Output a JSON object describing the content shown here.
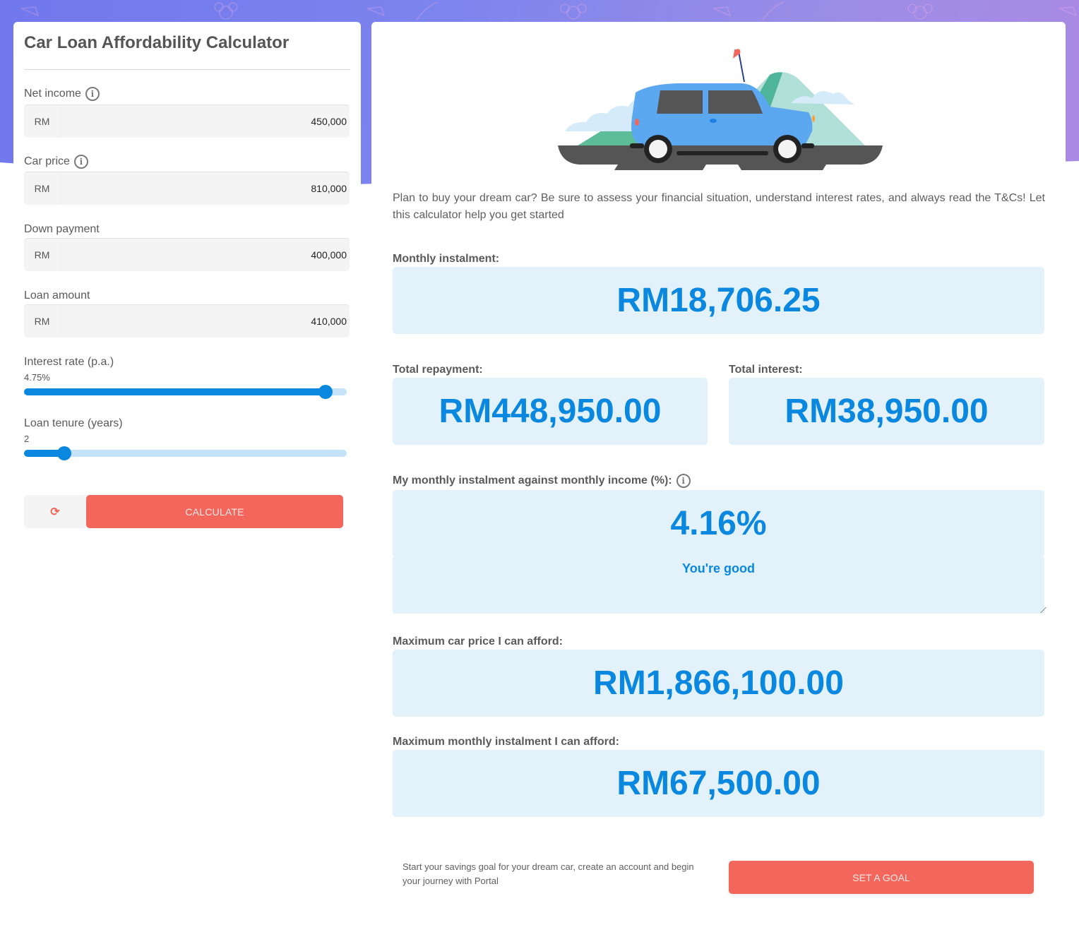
{
  "calculator": {
    "title": "Car Loan Affordability Calculator",
    "fields": [
      {
        "label": "Net income",
        "prefix": "RM",
        "value": "450,000",
        "has_info": true
      },
      {
        "label": "Car price",
        "prefix": "RM",
        "value": "810,000",
        "has_info": true
      },
      {
        "label": "Down payment",
        "prefix": "RM",
        "value": "400,000",
        "has_info": false
      },
      {
        "label": "Loan amount",
        "prefix": "RM",
        "value": "410,000",
        "has_info": false
      }
    ],
    "interest_rate": {
      "label": "Interest rate (p.a.)",
      "value_text": "4.75%",
      "fill_fraction": 0.935
    },
    "loan_tenure": {
      "label": "Loan tenure (years)",
      "value_text": "2",
      "fill_fraction": 0.125
    },
    "reset_icon": "refresh-icon",
    "reset_glyph": "⟳",
    "calculate_label": "CALCULATE",
    "info_glyph": "i"
  },
  "results": {
    "intro": "Plan to buy your dream car? Be sure to assess your financial situation, understand interest rates, and always read the T&Cs! Let this calculator help you get started",
    "monthly_instalment": {
      "label": "Monthly instalment:",
      "value": "RM18,706.25"
    },
    "total_repayment": {
      "label": "Total repayment:",
      "value": "RM448,950.00"
    },
    "total_interest": {
      "label": "Total interest:",
      "value": "RM38,950.00"
    },
    "instalment_vs_income": {
      "label": "My monthly instalment against monthly income (%):",
      "value": "4.16%",
      "status": "You're good"
    },
    "max_car_price": {
      "label": "Maximum car price I can afford:",
      "value": "RM1,866,100.00"
    },
    "max_monthly_instalment": {
      "label": "Maximum monthly instalment I can afford:",
      "value": "RM67,500.00"
    }
  },
  "goal": {
    "text": "Start your savings goal for your dream car, create an account and begin your journey with Portal",
    "button_label": "SET A GOAL"
  },
  "colors": {
    "accent_blue": "#0a88e0",
    "result_bg": "#e3f1fb",
    "button_coral": "#f2665c",
    "hero_gradient_start": "#7078ec",
    "hero_gradient_end": "#a98ae4"
  }
}
